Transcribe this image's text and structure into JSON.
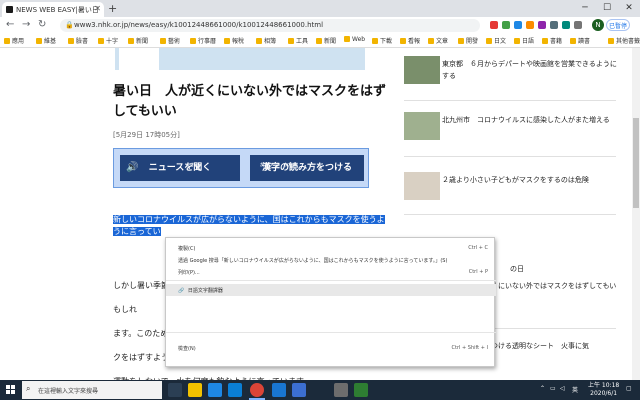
{
  "browser": {
    "tab_title": "NEWS WEB EASY|暑い日　人が",
    "tab_close": "✕",
    "new_tab": "+",
    "url": "www3.nhk.or.jp/news/easy/k10012448661000/k10012448661000.html",
    "avatar_letter": "N",
    "pause_label": "已暫停",
    "win_min": "─",
    "win_max": "☐",
    "win_close": "✕"
  },
  "bookmarks": [
    "應用",
    "維基",
    "臉書",
    "十字",
    "新聞",
    "藝術",
    "行事曆",
    "報稅",
    "相簿",
    "工具",
    "新聞",
    "Web",
    "下載",
    "看報",
    "文章",
    "開發",
    "日文",
    "日語",
    "書籍",
    "讀書",
    "其他書籤"
  ],
  "article": {
    "headline": "暑い日　人が近くにいない外ではマスクをはずしてもいい",
    "date": "[5月29日 17時05分]",
    "listen_btn": "ニュースを聞く",
    "listen_ruby": "き",
    "kanji_btn": "漢字の読み方をつける",
    "kanji_ruby": "かんじ　よ　かた",
    "para1_sel_line1": "新しいコロナウイルスが広がらないように、国はこれからもマスクを使うよ",
    "para1_sel_line2": "うに言ってい",
    "para2_line1": "しかし暑い季節",
    "para2_line1_end": "るかもしれ",
    "para2_line2": "ます。このため国は、外で人と人の間が２ｍ以上ある場合、暑かったらマス",
    "para2_line3": "クをはずすように言っています。そして、マスクをつけているときは激しい",
    "para2_line4": "運動をしないで、水を何度も飲むように言っています。"
  },
  "context_menu": {
    "items": [
      {
        "label": "複製(C)",
        "shortcut": "Ctrl + C"
      },
      {
        "label": "透過 Google 搜尋「新しいコロナウイルスが広がらないように、国はこれからもマスクを使うように言っています。」(S)",
        "shortcut": ""
      },
      {
        "label": "列印(P)...",
        "shortcut": "Ctrl + P"
      },
      {
        "label": "日語文字翻譯器",
        "shortcut": ""
      },
      {
        "label": "檢查(N)",
        "shortcut": "Ctrl + Shift + I"
      }
    ]
  },
  "sidebar": {
    "items": [
      "東京都　６月からデパートや映画館を営業できるようにする",
      "北九州市　コロナウイルスに感染した人がまた増える",
      "２歳より小さい子どもがマスクをするのは危険",
      "暑い日　人が近くにいない外ではマスクをはずしてもいい",
      "レジの前などにつける透明なシート　火事に気"
    ],
    "partial_label": "の日"
  },
  "taskbar": {
    "search_placeholder": "在這裡輸入文字來搜尋",
    "ime": "英",
    "time": "上午 10:18",
    "date": "2020/6/1"
  }
}
